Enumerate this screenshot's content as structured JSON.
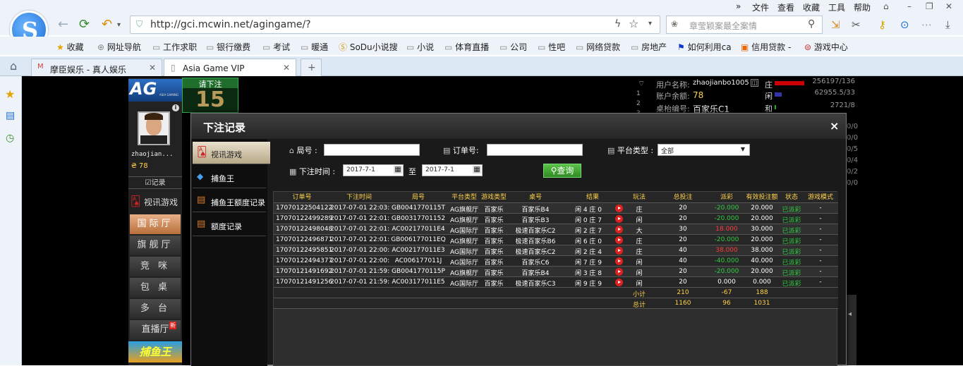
{
  "menubar": {
    "chevron": "»",
    "items": [
      "文件",
      "查看",
      "收藏",
      "工具",
      "帮助"
    ]
  },
  "toolbar": {
    "url": "http://gci.mcwin.net/agingame/?",
    "search_placeholder": "章莹颖案最全案情"
  },
  "bookmarks": [
    "收藏",
    "网址导航",
    "工作求职",
    "银行缴费",
    "考试",
    "暖通",
    "SoDu小说搜",
    "小说",
    "体育直播",
    "公司",
    "性吧",
    "网络贷款",
    "房地产",
    "如何利用ca",
    "信用贷款 -",
    "游戏中心"
  ],
  "tabs": [
    {
      "label": "摩臣娱乐 - 真人娱乐"
    },
    {
      "label": "Asia Game VIP"
    }
  ],
  "new_tab_label": "+",
  "game": {
    "brand": "AG",
    "brand_sub": "ASIA GAMING",
    "username_short": "zhaojian...",
    "balance_short": "78",
    "record_label": "记录",
    "video_game_label": "视讯游戏",
    "halls": [
      "国际厅",
      "旗舰厅",
      "竞 咪",
      "包 桌",
      "多 台",
      "直播厅"
    ],
    "new_badge": "新",
    "fish_banner": "捕鱼王",
    "bet_prompt": "请下注",
    "countdown": "15",
    "user_info": [
      {
        "label": "用户名称:",
        "value": "zhaojianbo1005"
      },
      {
        "label": "账户余额:",
        "value": "78"
      },
      {
        "label": "桌枱编号:",
        "value": "百家乐C1"
      }
    ],
    "stats": [
      {
        "label": "庄",
        "value": "256197/136",
        "color": "#c00"
      },
      {
        "label": "闲",
        "value": "62955.5/33",
        "color": "#33a"
      },
      {
        "label": "和",
        "value": "2721/8",
        "color": "#2a2"
      }
    ],
    "side_values": [
      "0/0",
      "0/0",
      "0/5",
      "0/4",
      "0/2",
      "0/0"
    ],
    "row_nums": [
      "1",
      "2",
      "3"
    ]
  },
  "dialog": {
    "title": "下注记录",
    "close": "×",
    "menu": [
      {
        "label": "视讯游戏"
      },
      {
        "label": "捕鱼王"
      },
      {
        "label": "捕鱼王额度记录"
      },
      {
        "label": "额度记录"
      }
    ],
    "filters": {
      "round_label": "局号 :",
      "order_label": "订单号:",
      "platform_label": "平台类型 :",
      "platform_value": "全部",
      "time_label": "下注时间 :",
      "date_from": "2017-7-1",
      "to_label": "至",
      "date_to": "2017-7-1",
      "query_button": "查询"
    },
    "headers": [
      "订单号",
      "下注时间",
      "局号",
      "平台类型",
      "游戏类型",
      "桌号",
      "结果",
      "玩法",
      "总投注",
      "派彩",
      "有效投注额",
      "状态",
      "游戏模式"
    ],
    "rows": [
      {
        "order": "17070122504122",
        "time": "2017-07-01 22:03:",
        "round": "GB0041770115T",
        "platform": "AG旗舰厅",
        "game": "百家乐",
        "table": "百家乐B4",
        "result": "闲 4 庄 0",
        "play": "庄",
        "bet": "20",
        "payout": "-20.000",
        "payout_color": "green",
        "valid": "20.000",
        "status": "已派彩",
        "mode": "-"
      },
      {
        "order": "17070122499289",
        "time": "2017-07-01 22:01:",
        "round": "GB00317701152",
        "platform": "AG旗舰厅",
        "game": "百家乐",
        "table": "百家乐B3",
        "result": "闲 0 庄 7",
        "play": "闲",
        "bet": "20",
        "payout": "-20.000",
        "payout_color": "green",
        "valid": "20.000",
        "status": "已派彩",
        "mode": "-"
      },
      {
        "order": "17070122498048",
        "time": "2017-07-01 22:01:",
        "round": "AC002177011E4",
        "platform": "AG国际厅",
        "game": "百家乐",
        "table": "极速百家乐C2",
        "result": "闲 2 庄 7",
        "play": "大",
        "bet": "30",
        "payout": "18.000",
        "payout_color": "red",
        "valid": "30.000",
        "status": "已派彩",
        "mode": "-"
      },
      {
        "order": "17070122496871",
        "time": "2017-07-01 22:01:",
        "round": "GB006177011EQ",
        "platform": "AG旗舰厅",
        "game": "百家乐",
        "table": "极速百家乐B6",
        "result": "闲 6 庄 0",
        "play": "庄",
        "bet": "20",
        "payout": "-20.000",
        "payout_color": "green",
        "valid": "20.000",
        "status": "已派彩",
        "mode": "-"
      },
      {
        "order": "17070122495851",
        "time": "2017-07-01 22:00:",
        "round": "AC002177011E3",
        "platform": "AG国际厅",
        "game": "百家乐",
        "table": "极速百家乐C2",
        "result": "闲 2 庄 4",
        "play": "庄",
        "bet": "40",
        "payout": "38.000",
        "payout_color": "red",
        "valid": "38.000",
        "status": "已派彩",
        "mode": "-"
      },
      {
        "order": "17070122494377",
        "time": "2017-07-01 22:00:",
        "round": "AC006177011J",
        "platform": "AG国际厅",
        "game": "百家乐",
        "table": "百家乐C6",
        "result": "闲 7 庄 9",
        "play": "闲",
        "bet": "40",
        "payout": "-40.000",
        "payout_color": "green",
        "valid": "40.000",
        "status": "已派彩",
        "mode": "-"
      },
      {
        "order": "17070121491692",
        "time": "2017-07-01 21:59:",
        "round": "GB0041770115P",
        "platform": "AG旗舰厅",
        "game": "百家乐",
        "table": "百家乐B4",
        "result": "闲 3 庄 8",
        "play": "闲",
        "bet": "20",
        "payout": "-20.000",
        "payout_color": "green",
        "valid": "20.000",
        "status": "已派彩",
        "mode": "-"
      },
      {
        "order": "17070121491256",
        "time": "2017-07-01 21:59:",
        "round": "AC003177011E5",
        "platform": "AG国际厅",
        "game": "百家乐",
        "table": "极速百家乐C3",
        "result": "闲 9 庄 9",
        "play": "闲",
        "bet": "20",
        "payout": "0.000",
        "payout_color": "white",
        "valid": "0.000",
        "status": "已派彩",
        "mode": "-"
      }
    ],
    "subtotal": {
      "label": "小计",
      "bet": "210",
      "payout": "-67",
      "valid": "188"
    },
    "total": {
      "label": "总计",
      "bet": "1160",
      "payout": "96",
      "valid": "1031"
    }
  }
}
